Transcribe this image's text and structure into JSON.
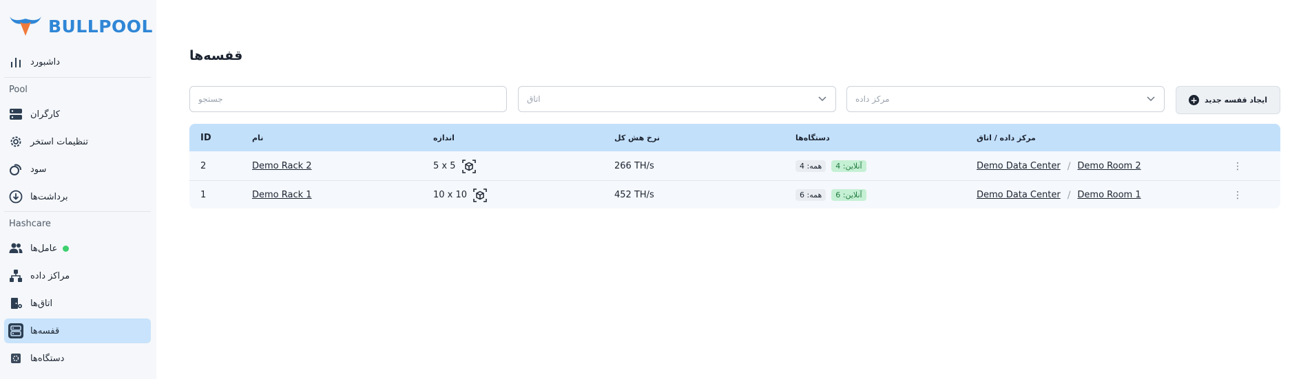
{
  "brand": {
    "name": "BULLPOOL",
    "logo_icon": "bull-horns-logo"
  },
  "sidebar": {
    "sections": {
      "pool": "Pool",
      "hashcare": "Hashcare"
    },
    "items": [
      {
        "label": "داشبورد",
        "icon": "bar-chart-icon"
      },
      {
        "label": "کارگران",
        "icon": "server-icon"
      },
      {
        "label": "تنظیمات استخر",
        "icon": "gear-icon"
      },
      {
        "label": "سود",
        "icon": "coins-icon"
      },
      {
        "label": "برداشت‌ها",
        "icon": "download-circle-icon"
      },
      {
        "label": "عامل‌ها",
        "icon": "users-icon",
        "status_color": "#3ecf6e"
      },
      {
        "label": "مراکز داده",
        "icon": "network-icon"
      },
      {
        "label": "اتاق‌ها",
        "icon": "door-icon"
      },
      {
        "label": "قفسه‌ها",
        "icon": "rack-icon",
        "active": true
      },
      {
        "label": "دستگاه‌ها",
        "icon": "chip-icon"
      }
    ]
  },
  "main": {
    "title": "قفسه‌ها",
    "search_placeholder": "جستجو",
    "room_select_placeholder": "اتاق",
    "datacenter_select_placeholder": "مرکز داده",
    "create_button": "ایجاد قفسه جدید"
  },
  "table": {
    "headers": {
      "id": "ID",
      "name": "نام",
      "size": "اندازه",
      "hashrate": "نرخ هش کل",
      "devices": "دستگاه‌ها",
      "location": "مرکز داده / اتاق"
    },
    "rows": [
      {
        "id": "2",
        "name": "Demo Rack 2",
        "size": "5 x 5",
        "hashrate": "266 TH/s",
        "online": "آنلاین: 4",
        "total": "همه: 4",
        "datacenter": "Demo Data Center",
        "room": "Demo Room 2"
      },
      {
        "id": "1",
        "name": "Demo Rack 1",
        "size": "10 x 10",
        "hashrate": "452 TH/s",
        "online": "آنلاین: 6",
        "total": "همه: 6",
        "datacenter": "Demo Data Center",
        "room": "Demo Room 1"
      }
    ]
  },
  "colors": {
    "accent": "#2f86d6",
    "active_bg": "#c8e3fb",
    "header_bg": "#c3e0fb",
    "online_badge": "#c5f0d4"
  }
}
